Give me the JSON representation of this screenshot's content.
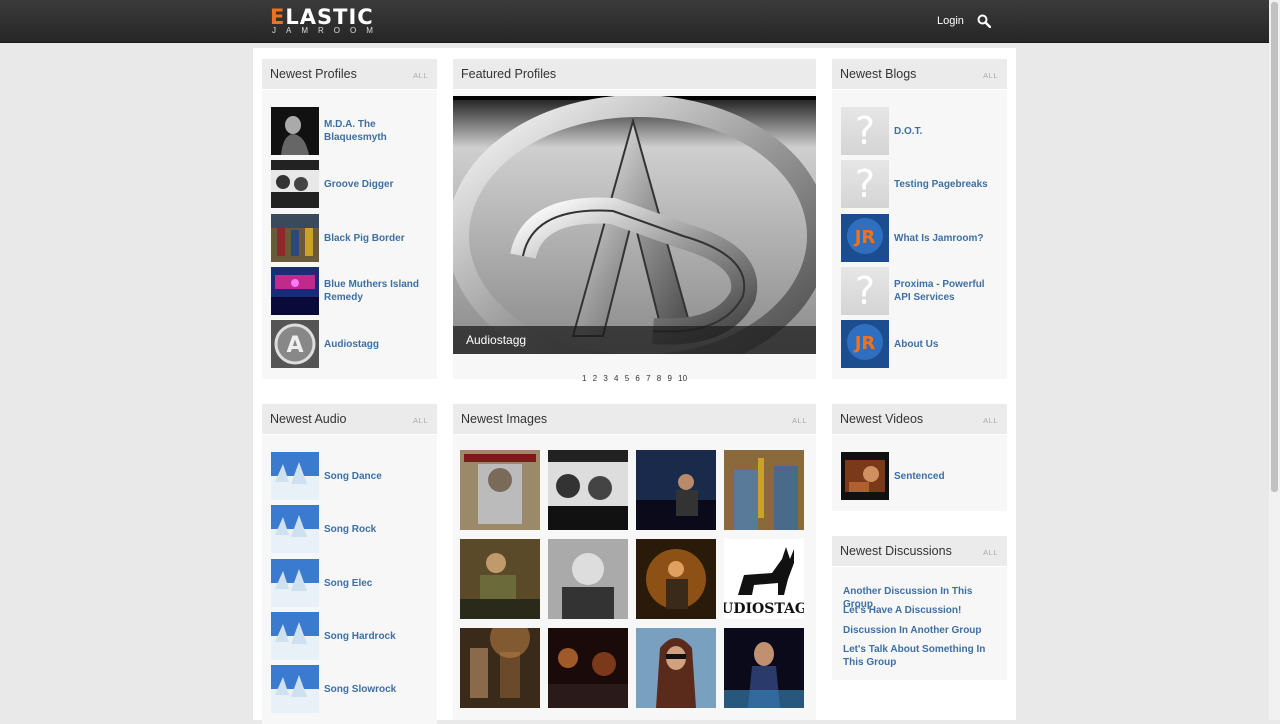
{
  "header": {
    "logo_main": "LASTIC",
    "logo_e": "E",
    "logo_sub": "JAMROOM",
    "login_label": "Login"
  },
  "newest_profiles": {
    "title": "Newest Profiles",
    "all": "ALL",
    "items": [
      {
        "label": "M.D.A. The Blaquesmyth"
      },
      {
        "label": "Groove Digger"
      },
      {
        "label": "Black Pig Border"
      },
      {
        "label": "Blue Muthers Island Remedy"
      },
      {
        "label": "Audiostagg"
      }
    ]
  },
  "featured_profiles": {
    "title": "Featured Profiles",
    "caption": "Audiostagg",
    "pages": [
      "1",
      "2",
      "3",
      "4",
      "5",
      "6",
      "7",
      "8",
      "9",
      "10"
    ]
  },
  "newest_blogs": {
    "title": "Newest Blogs",
    "all": "ALL",
    "items": [
      {
        "label": "D.O.T."
      },
      {
        "label": "Testing Pagebreaks"
      },
      {
        "label": "What Is Jamroom?"
      },
      {
        "label": "Proxima - Powerful API Services"
      },
      {
        "label": "About Us"
      }
    ]
  },
  "newest_audio": {
    "title": "Newest Audio",
    "all": "ALL",
    "items": [
      {
        "label": "Song Dance"
      },
      {
        "label": "Song Rock"
      },
      {
        "label": "Song Elec"
      },
      {
        "label": "Song Hardrock"
      },
      {
        "label": "Song Slowrock"
      }
    ]
  },
  "newest_images": {
    "title": "Newest Images",
    "all": "ALL"
  },
  "newest_videos": {
    "title": "Newest Videos",
    "all": "ALL",
    "items": [
      {
        "label": "Sentenced"
      }
    ]
  },
  "newest_discussions": {
    "title": "Newest Discussions",
    "all": "ALL",
    "items": [
      {
        "label": "Another Discussion In This Group"
      },
      {
        "label": "Let's Have A Discussion!"
      },
      {
        "label": "Discussion In Another Group"
      },
      {
        "label": "Let's Talk About Something In This Group"
      }
    ]
  },
  "colors": {
    "link": "#3e6fa3",
    "accent": "#f2711c",
    "header_bg": "#2f2f2f"
  }
}
